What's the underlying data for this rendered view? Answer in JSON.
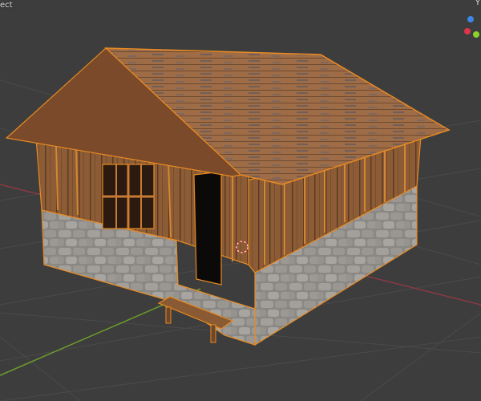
{
  "viewport": {
    "mode_label": "ect",
    "gizmo_top_label": "Y",
    "gizmo_colors": {
      "x": "#e0344d",
      "y": "#8bd22a",
      "z": "#3f86e6"
    },
    "background_color": "#3d3d3d",
    "grid_color": "#494949",
    "x_axis_color": "#8a3a44",
    "y_axis_color": "#6c9a2c",
    "selection_outline_color": "#e98b22"
  },
  "object": {
    "name": "cabin",
    "roof_color": "#9c6a45",
    "wood_color": "#8a5a34",
    "stone_color": "#8c8a86"
  }
}
